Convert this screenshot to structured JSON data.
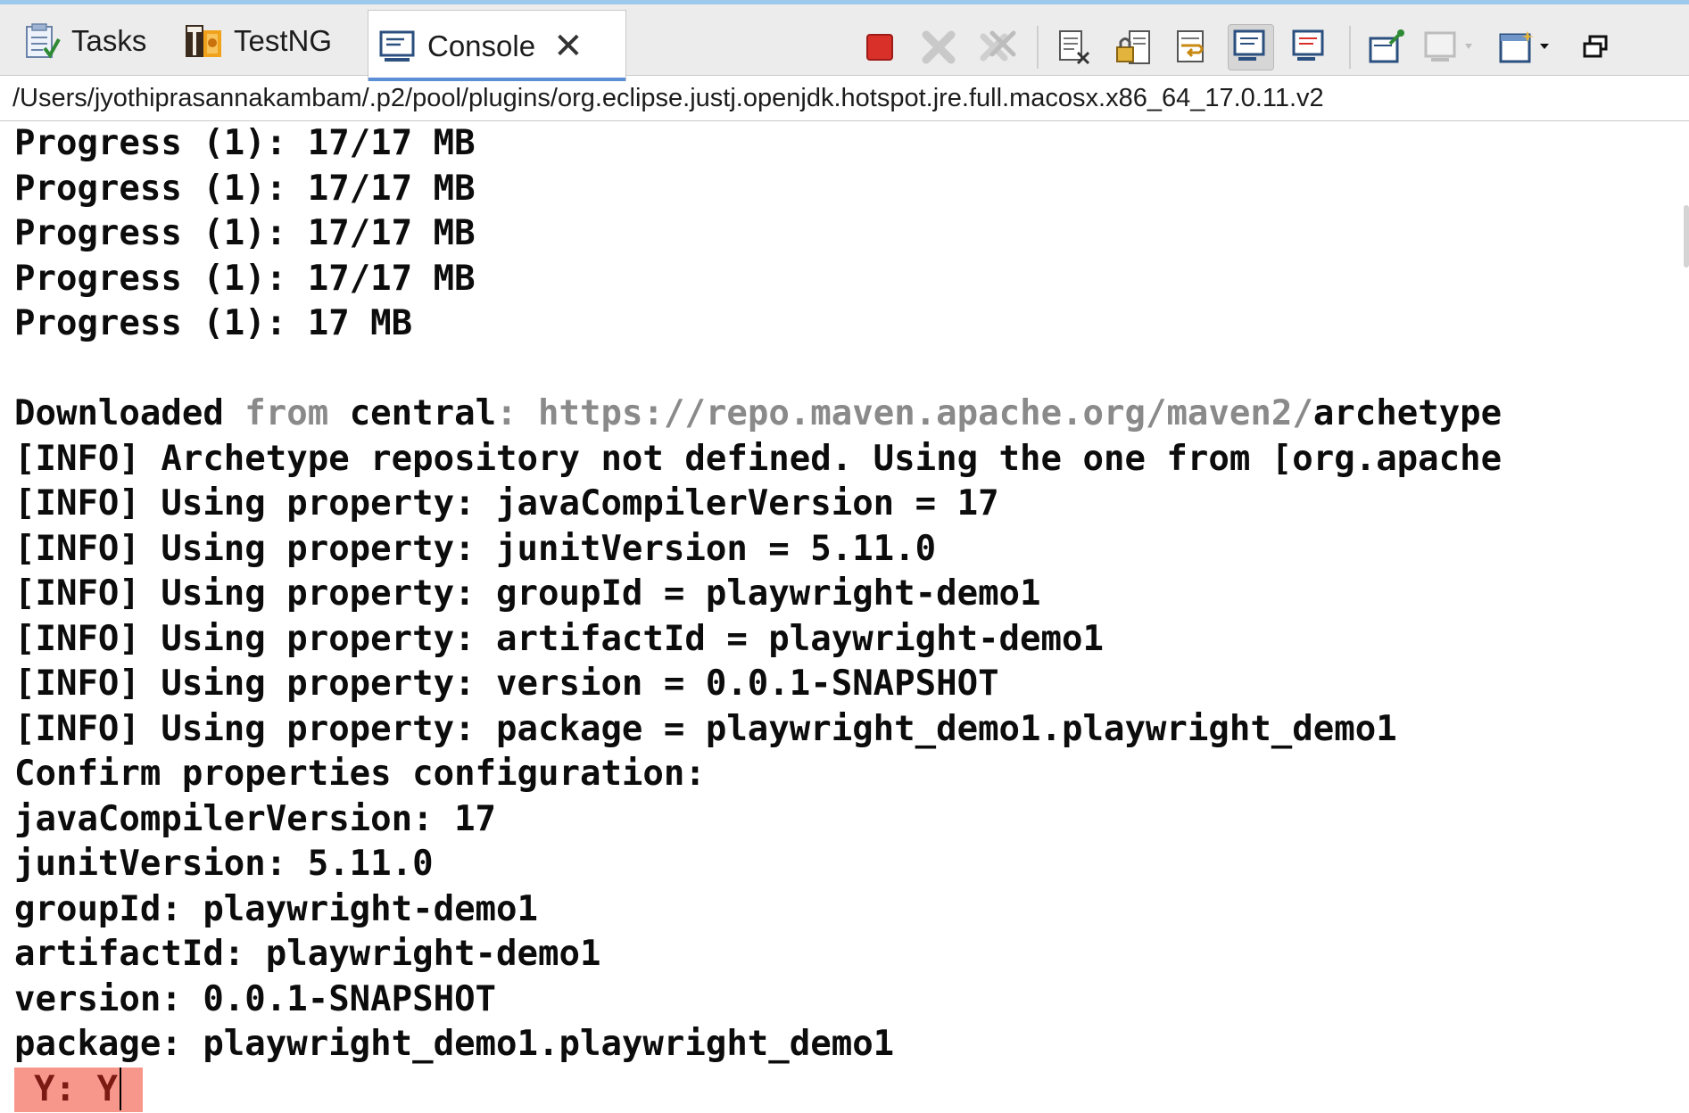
{
  "tabs": [
    {
      "label": "Tasks",
      "icon": "tasks-icon"
    },
    {
      "label": "TestNG",
      "icon": "testng-icon"
    },
    {
      "label": "Console",
      "icon": "console-icon",
      "active": true
    }
  ],
  "toolbar": {
    "buttons": [
      "terminate-icon",
      "remove-launch-icon",
      "remove-all-terminated-icon",
      "clear-console-icon",
      "scroll-lock-icon",
      "word-wrap-icon",
      "show-console-on-stdout-icon",
      "show-console-on-stderr-icon",
      "pin-console-icon",
      "display-selected-console-icon",
      "open-console-icon",
      "maximize-view-icon"
    ]
  },
  "path": "/Users/jyothiprasannakambam/.p2/pool/plugins/org.eclipse.justj.openjdk.hotspot.jre.full.macosx.x86_64_17.0.11.v2",
  "console": {
    "progress": [
      "Progress (1): 17/17 MB",
      "Progress (1): 17/17 MB",
      "Progress (1): 17/17 MB",
      "Progress (1): 17/17 MB",
      "Progress (1): 17 MB"
    ],
    "downloaded": {
      "word": "Downloaded",
      "from": " from ",
      "central": "central",
      "colon": ": ",
      "url": "https://repo.maven.apache.org/maven2/",
      "tail": "archetype"
    },
    "lines": [
      "[INFO] Archetype repository not defined. Using the one from [org.apache",
      "[INFO] Using property: javaCompilerVersion = 17",
      "[INFO] Using property: junitVersion = 5.11.0",
      "[INFO] Using property: groupId = playwright-demo1",
      "[INFO] Using property: artifactId = playwright-demo1",
      "[INFO] Using property: version = 0.0.1-SNAPSHOT",
      "[INFO] Using property: package = playwright_demo1.playwright_demo1",
      "Confirm properties configuration:",
      "javaCompilerVersion: 17",
      "junitVersion: 5.11.0",
      "groupId: playwright-demo1",
      "artifactId: playwright-demo1",
      "version: 0.0.1-SNAPSHOT",
      "package: playwright_demo1.playwright_demo1"
    ],
    "input": "Y: Y"
  },
  "colors": {
    "input_highlight": "#f7978c",
    "active_tab_underline": "#5a8fd6",
    "terminate_red": "#d9302a"
  }
}
